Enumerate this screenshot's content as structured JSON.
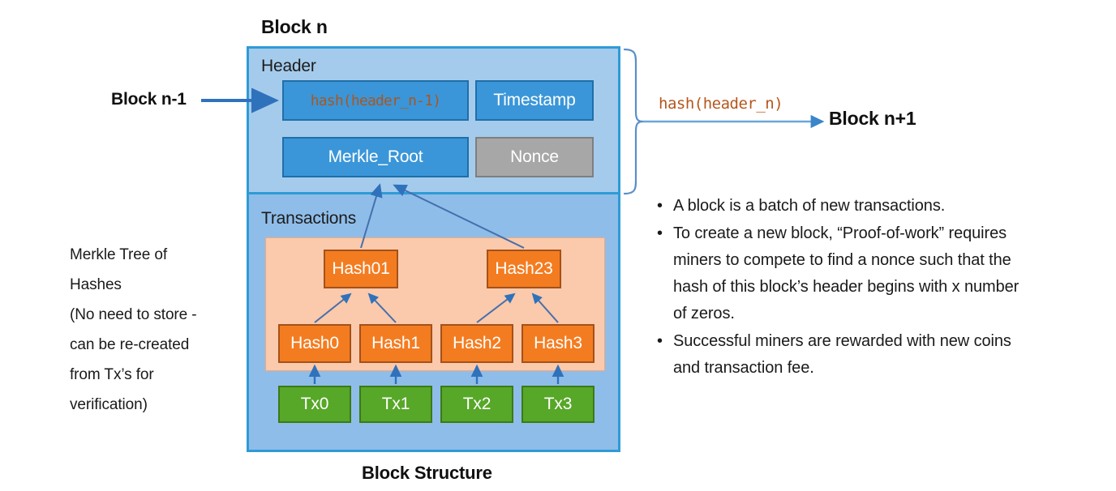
{
  "diagram": {
    "title": "Block n",
    "caption": "Block Structure",
    "prev_block_label": "Block n-1",
    "next_block_label": "Block n+1",
    "outgoing_hash_label": "hash(header_n)"
  },
  "block": {
    "header_section_label": "Header",
    "transactions_section_label": "Transactions",
    "header_fields": [
      {
        "name": "prev-hash",
        "label": "hash(header_n-1)",
        "style": "blue-code"
      },
      {
        "name": "timestamp",
        "label": "Timestamp",
        "style": "blue"
      },
      {
        "name": "merkle-root",
        "label": "Merkle_Root",
        "style": "blue"
      },
      {
        "name": "nonce",
        "label": "Nonce",
        "style": "gray"
      }
    ]
  },
  "merkle_tree": {
    "level2": [
      {
        "label": "Hash01"
      },
      {
        "label": "Hash23"
      }
    ],
    "level1": [
      {
        "label": "Hash0"
      },
      {
        "label": "Hash1"
      },
      {
        "label": "Hash2"
      },
      {
        "label": "Hash3"
      }
    ],
    "transactions": [
      {
        "label": "Tx0"
      },
      {
        "label": "Tx1"
      },
      {
        "label": "Tx2"
      },
      {
        "label": "Tx3"
      }
    ]
  },
  "left_note": {
    "lines": [
      "Merkle Tree of",
      "Hashes",
      "(No need to store -",
      "can be re-created",
      "from Tx’s for",
      "verification)"
    ]
  },
  "bullets": [
    "A block is a batch of new transactions.",
    "To create a new block, “Proof-of-work” requires miners to compete to find a nonce such that the hash of this block’s header begins with x number of zeros.",
    "Successful miners are rewarded with new coins and transaction fee."
  ],
  "colors": {
    "block_fill": "#8fbde9",
    "block_border": "#2e9bd6",
    "header_fill": "#a5cbec",
    "field_blue": "#3a96d8",
    "field_blue_border": "#1f6fa8",
    "field_gray": "#a7a7a7",
    "field_gray_border": "#7f7f7f",
    "merkle_panel": "#fbc9ab",
    "hash_box": "#f47c20",
    "hash_box_border": "#a4511a",
    "tx_box": "#57a728",
    "tx_box_border": "#3b7a16",
    "arrow_blue": "#3a6fb5",
    "hash_text": "#b5561d",
    "brace": "#5b8fc9"
  }
}
